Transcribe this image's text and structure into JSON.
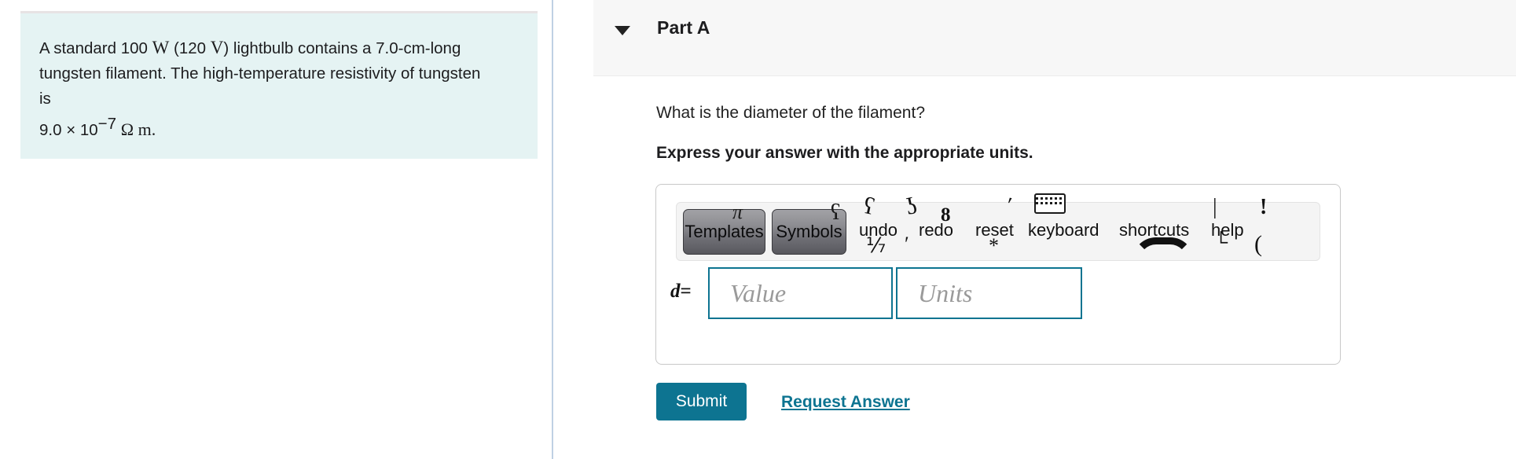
{
  "problem": {
    "text_part1": "A standard 100 ",
    "unit_watt": "W",
    "text_part2": " (120 ",
    "unit_volt": "V",
    "text_part3": ") lightbulb contains a 7.0-cm-long tungsten filament. The high-temperature resistivity of tungsten is",
    "resistivity_mantissa": "9.0 × 10",
    "resistivity_exponent": "−7",
    "resistivity_units": "Ω m."
  },
  "part": {
    "collapse_icon": "caret-down-icon",
    "title": "Part A",
    "question": "What is the diameter of the filament?",
    "instruction": "Express your answer with the appropriate units."
  },
  "toolbar": {
    "templates_label": "Templates",
    "templates_glyph": "π",
    "symbols_label": "Symbols",
    "symbols_glyph": "ʕ",
    "undo_label": "undo",
    "redo_label": "redo",
    "reset_label": "reset",
    "keyboard_label": "keyboard",
    "shortcuts_label": "shortcuts",
    "help_label": "help",
    "deco": {
      "d1": "ʕ",
      "d2": "ʖ",
      "d3": "⅐",
      "d4": "′",
      "d5": "8",
      "d6": "′",
      "d7": "*",
      "d8": "|",
      "d9": "!",
      "d10": "└",
      "d11": "("
    }
  },
  "answer": {
    "variable": "d",
    "equals": "=",
    "value_placeholder": "Value",
    "value": "",
    "units_placeholder": "Units",
    "units": ""
  },
  "actions": {
    "submit_label": "Submit",
    "request_answer_label": "Request Answer"
  },
  "colors": {
    "accent_teal": "#0d7491",
    "problem_bg": "#e5f3f3",
    "part_header_bg": "#f7f7f7",
    "divider": "#bfd0e4",
    "toolbar_bg": "#f4f4f4"
  }
}
